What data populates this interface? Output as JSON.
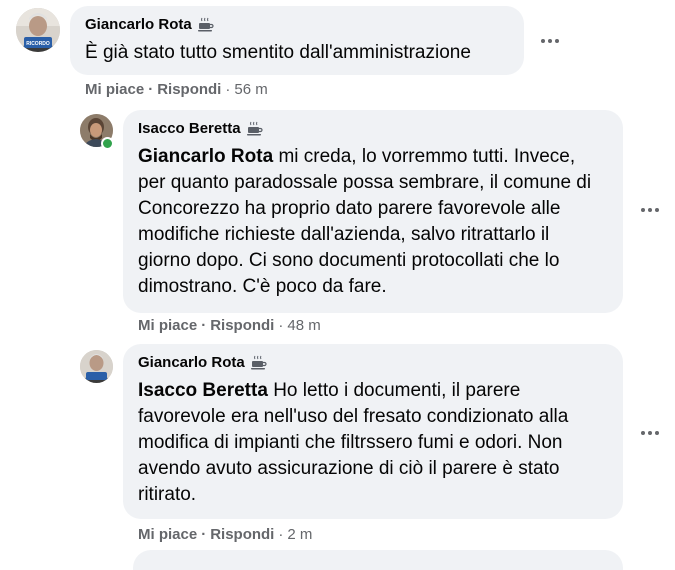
{
  "comments": [
    {
      "author": "Giancarlo Rota",
      "mention": "",
      "text": "È già stato tutto smentito dall'amministrazione",
      "like_label": "Mi piace",
      "reply_label": "Rispondi",
      "time": "56 m"
    },
    {
      "author": "Isacco Beretta",
      "mention": "Giancarlo Rota",
      "text": "mi creda, lo vorremmo tutti. Invece, per quanto paradossale possa sembrare, il comune di Concorezzo ha proprio dato parere favorevole alle modifiche richieste dall'azienda, salvo ritrattarlo il giorno dopo. Ci sono documenti protocollati che lo dimostrano. C'è poco da fare.",
      "like_label": "Mi piace",
      "reply_label": "Rispondi",
      "time": "48 m"
    },
    {
      "author": "Giancarlo Rota",
      "mention": "Isacco Beretta",
      "text": "Ho letto i documenti, il parere favorevole era nell'uso del fresato condizionato alla modifica di impianti che filtrssero fumi e odori. Non avendo avuto assicurazione di ciò il parere è stato ritirato.",
      "like_label": "Mi piace",
      "reply_label": "Rispondi",
      "time": "2 m"
    }
  ],
  "avatar_badge_text": "RICORDO",
  "icons": {
    "badge": "coffee-cup-icon",
    "more": "more-options-icon"
  },
  "colors": {
    "bubble": "#f0f2f5",
    "meta_text": "#65676b",
    "online": "#31a24c"
  }
}
